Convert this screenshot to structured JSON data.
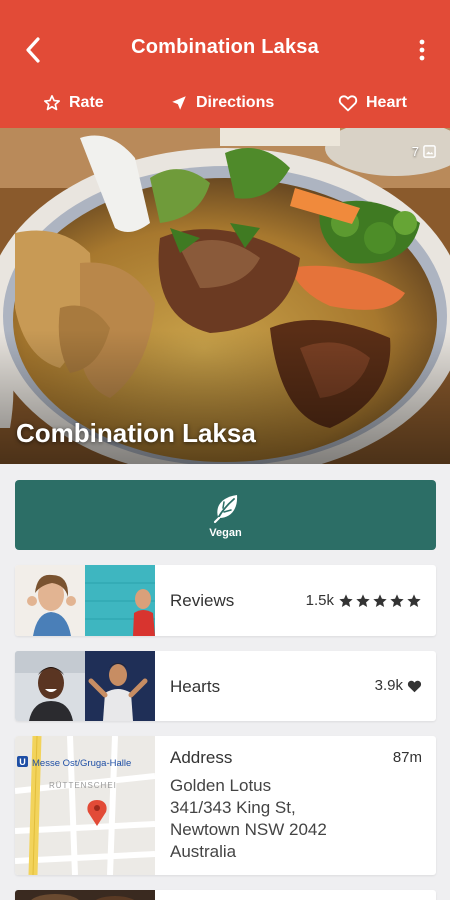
{
  "header": {
    "title": "Combination Laksa",
    "actions": [
      {
        "label": "Rate",
        "icon": "star-outline-icon"
      },
      {
        "label": "Directions",
        "icon": "navigation-icon"
      },
      {
        "label": "Heart",
        "icon": "heart-outline-icon"
      }
    ]
  },
  "hero": {
    "title": "Combination Laksa",
    "photo_count": "7"
  },
  "tag": {
    "label": "Vegan",
    "icon": "leaf-icon"
  },
  "reviews": {
    "label": "Reviews",
    "count": "1.5k",
    "rating": 5
  },
  "hearts": {
    "label": "Hearts",
    "count": "3.9k"
  },
  "address": {
    "label": "Address",
    "distance": "87m",
    "lines": [
      "Golden Lotus",
      "341/343 King St,",
      "Newtown NSW 2042",
      "Australia"
    ],
    "map_labels": [
      "Messe Ost/Gruga-Halle",
      "RÜTTENSCHEI"
    ]
  },
  "colors": {
    "primary": "#e24b37",
    "vegan": "#2c6e66",
    "background": "#efeff1"
  }
}
